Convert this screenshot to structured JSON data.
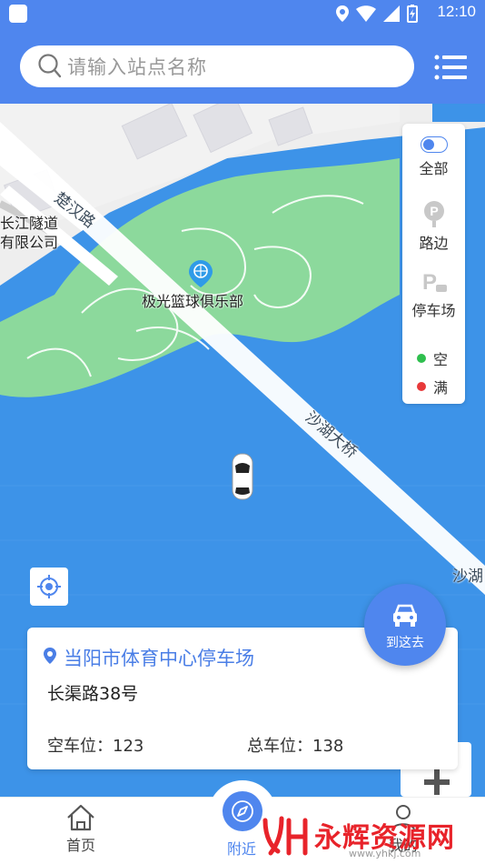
{
  "status_bar": {
    "time": "12:10",
    "icons": [
      "app-icon",
      "location-icon",
      "wifi-icon",
      "signal-icon",
      "battery-icon"
    ]
  },
  "header": {
    "search_placeholder": "请输入站点名称",
    "menu_icon": "menu-icon"
  },
  "map": {
    "labels": {
      "road_chuhan": "楚汉路",
      "tunnel": "长江隧道",
      "company": "有限公司",
      "poi": "极光篮球俱乐部",
      "bridge": "沙湖大桥",
      "shahu": "沙湖"
    },
    "filter": {
      "all": "全部",
      "roadside": "路边",
      "parking": "停车场",
      "legend_empty": "空",
      "legend_full": "满"
    },
    "colors": {
      "water": "#3d93e8",
      "park": "#8cd99c",
      "urban": "#eeeeee",
      "empty": "#2fbf4e",
      "full": "#e8393a",
      "accent": "#4f86ee"
    }
  },
  "info_card": {
    "station_name": "当阳市体育中心停车场",
    "address": "长渠路38号",
    "empty_spaces": "空车位：123",
    "total_spaces": "总车位：138"
  },
  "go_button": {
    "label": "到这去"
  },
  "bottom_nav": {
    "home": "首页",
    "nearby": "附近",
    "profile": "我的"
  },
  "watermark": {
    "text": "永辉资源网",
    "url": "www.yhkj.com"
  }
}
